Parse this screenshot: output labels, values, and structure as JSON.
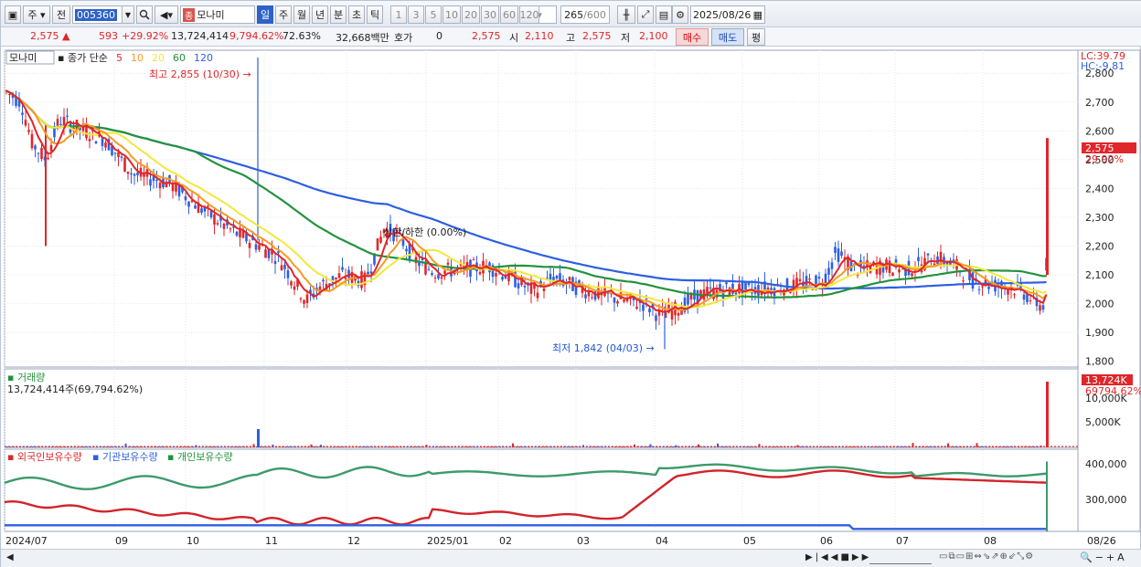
{
  "toolbar": {
    "period_label": "주",
    "prev_label": "전",
    "code_value": "005360",
    "stock_name": "모나미",
    "stock_badge": "종",
    "tabs": [
      "일",
      "주",
      "월",
      "년",
      "분",
      "초",
      "틱"
    ],
    "active_tab": "일",
    "intervals": [
      "1",
      "3",
      "5",
      "10",
      "20",
      "30",
      "60",
      "120"
    ],
    "count": "265",
    "count_total": "/600",
    "date": "2025/08/26"
  },
  "quote": {
    "price": "2,575",
    "change": "593",
    "change_pct": "+29.92%",
    "volume": "13,724,414",
    "volume_pct": "9,794.62%",
    "turnover": "72.63%",
    "amount": "32,668백만",
    "hoga_label": "호가",
    "hoga_value": "0",
    "hoga_price": "2,575",
    "open_label": "시",
    "open": "2,110",
    "high_label": "고",
    "high": "2,575",
    "low_label": "저",
    "low": "2,100",
    "buy_label": "매수",
    "sell_label": "매도",
    "avg_label": "평"
  },
  "main_chart": {
    "stock_label": "모나미",
    "legend_title": "종가 단순",
    "ma_periods": [
      "5",
      "10",
      "20",
      "60",
      "120"
    ],
    "lc": "LC:39.79",
    "hc": "HC:-9.81",
    "high_annotation": "최고 2,855 (10/30)",
    "low_annotation": "최저 1,842 (04/03)",
    "mid_annotation": "상한/하한 (0.00%)",
    "price_tag": "2,575",
    "pct_tag": "29.92%",
    "y_ticks": [
      "2,800",
      "2,700",
      "2,600",
      "2,500",
      "2,400",
      "2,300",
      "2,200",
      "2,100",
      "2,000",
      "1,900",
      "1,800"
    ],
    "colors": {
      "ma5": "#e0262a",
      "ma10": "#f59a23",
      "ma20": "#f3e83a",
      "ma60": "#23923d",
      "ma120": "#2d5fe0"
    }
  },
  "volume_chart": {
    "title": "거래량",
    "value": "13,724,414주(69,794.62%)",
    "tag": "13,724K",
    "tag_pct": "69794.62%",
    "y_ticks": [
      "10,000K",
      "5,000K"
    ]
  },
  "holdings_chart": {
    "legend": [
      "외국인보유수량",
      "기관보유수량",
      "개인보유수량"
    ],
    "y_ticks": [
      "400,000",
      "300,000"
    ]
  },
  "x_axis": [
    "2024/07",
    "09",
    "10",
    "11",
    "12",
    "2025/01",
    "02",
    "03",
    "04",
    "05",
    "06",
    "07",
    "08",
    "08/26"
  ]
}
